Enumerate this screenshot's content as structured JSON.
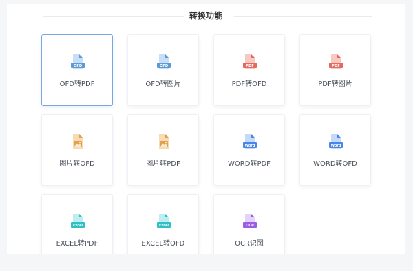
{
  "section": {
    "title": "转换功能"
  },
  "cards": [
    {
      "label": "OFD转PDF",
      "badge": "OFD",
      "icon": "ofd-file-icon",
      "selected": true
    },
    {
      "label": "OFD转图片",
      "badge": "OFD",
      "icon": "ofd-file-icon"
    },
    {
      "label": "PDF转OFD",
      "badge": "PDF",
      "icon": "pdf-file-icon"
    },
    {
      "label": "PDF转图片",
      "badge": "PDF",
      "icon": "pdf-file-icon"
    },
    {
      "label": "图片转OFD",
      "icon": "image-file-icon"
    },
    {
      "label": "图片转PDF",
      "icon": "image-file-icon"
    },
    {
      "label": "WORD转PDF",
      "badge": "Word",
      "icon": "word-file-icon"
    },
    {
      "label": "WORD转OFD",
      "badge": "Word",
      "icon": "word-file-icon"
    },
    {
      "label": "EXCEL转PDF",
      "badge": "Excel",
      "icon": "excel-file-icon"
    },
    {
      "label": "EXCEL转OFD",
      "badge": "Excel",
      "icon": "excel-file-icon"
    },
    {
      "label": "OCR识图",
      "badge": "OCR",
      "icon": "ocr-file-icon"
    }
  ],
  "colors": {
    "ofd": "#5b9bd8",
    "pdf": "#e46a5f",
    "image": "#e2a04c",
    "word": "#4a86e8",
    "excel": "#2fc0c6",
    "ocr": "#9b5de5",
    "selected_border": "#7aa7e0"
  }
}
